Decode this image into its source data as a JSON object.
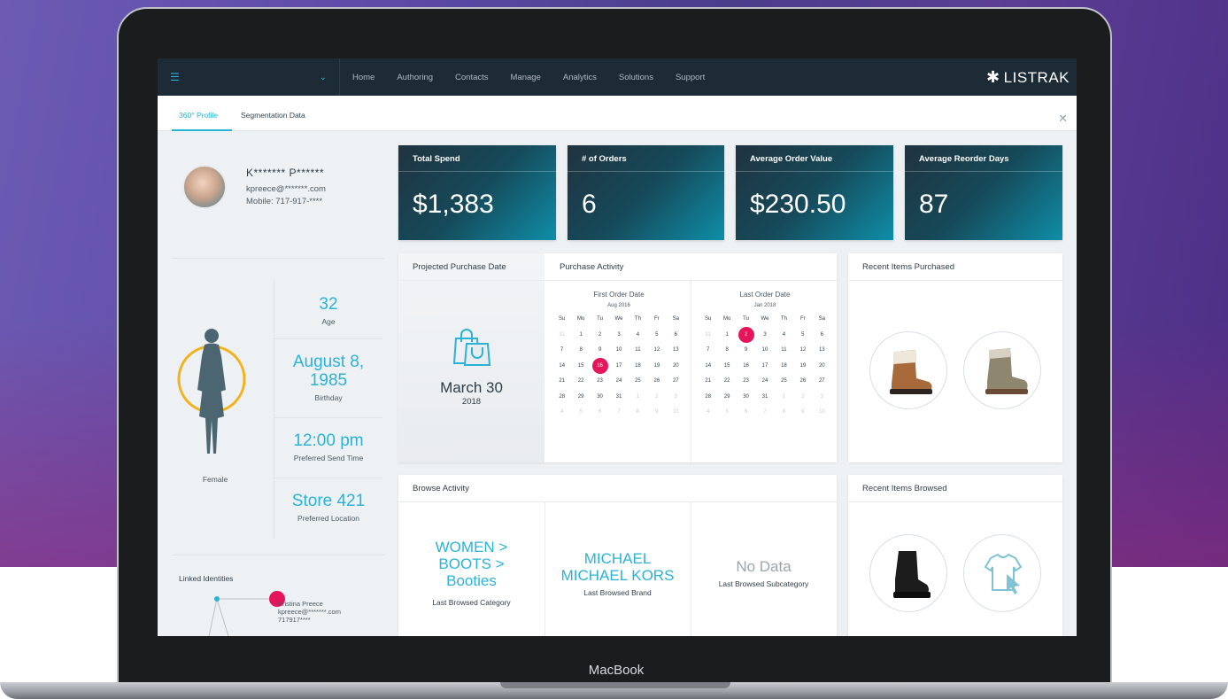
{
  "device_label": "MacBook",
  "topbar": {
    "nav": [
      "Home",
      "Authoring",
      "Contacts",
      "Manage",
      "Analytics",
      "Solutions",
      "Support"
    ],
    "brand": "LISTRAK"
  },
  "tabs": [
    "360° Profile",
    "Segmentation Data"
  ],
  "profile": {
    "name": "K******* P******",
    "email": "kpreece@*******.com",
    "mobile": "Mobile: 717-917-****",
    "gender": "Female",
    "stats": [
      {
        "value": "32",
        "label": "Age"
      },
      {
        "value": "August 8, 1985",
        "label": "Birthday"
      },
      {
        "value": "12:00 pm",
        "label": "Preferred Send Time"
      },
      {
        "value": "Store 421",
        "label": "Preferred Location"
      }
    ],
    "linked_title": "Linked Identities",
    "linked": {
      "name": "Kristina Preece",
      "email": "kpreece@*******.com",
      "phone": "717917****"
    }
  },
  "kpis": [
    {
      "title": "Total Spend",
      "value": "$1,383"
    },
    {
      "title": "# of Orders",
      "value": "6"
    },
    {
      "title": "Average Order Value",
      "value": "$230.50"
    },
    {
      "title": "Average Reorder Days",
      "value": "87"
    }
  ],
  "projected": {
    "title": "Projected Purchase Date",
    "date": "March 30",
    "year": "2018"
  },
  "activity": {
    "title": "Purchase Activity",
    "first": {
      "title": "First Order Date",
      "month": "Aug 2016"
    },
    "last": {
      "title": "Last Order Date",
      "month": "Jan 2018"
    },
    "weekdays": [
      "Su",
      "Mo",
      "Tu",
      "We",
      "Th",
      "Fr",
      "Sa"
    ]
  },
  "recent_purchased": {
    "title": "Recent Items Purchased"
  },
  "browse": {
    "title": "Browse Activity",
    "category": {
      "value": "WOMEN > BOOTS > Booties",
      "label": "Last Browsed Category"
    },
    "brand": {
      "value": "MICHAEL MICHAEL KORS",
      "label": "Last Browsed Brand"
    },
    "subcategory": {
      "value": "No Data",
      "label": "Last Browsed Subcategory"
    }
  },
  "recent_browsed": {
    "title": "Recent Items Browsed"
  },
  "colors": {
    "accent": "#2ab3d6",
    "highlight": "#e5145b",
    "nav_bg": "#1d2b36"
  }
}
